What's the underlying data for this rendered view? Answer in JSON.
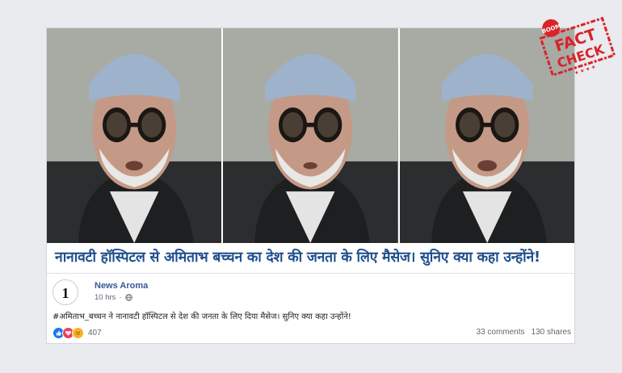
{
  "headline": "नानावटी हॉस्पिटल से अमिताभ बच्चन का देश की जनता के लिए मैसेज। सुनिए क्या कहा उन्होंने!",
  "post": {
    "page_name": "News Aroma",
    "time": "10 hrs",
    "separator": "·",
    "text": "#अमिताभ_बच्चन ने नानावटी हॉस्पिटल से देश की जनता के लिए दिया मैसेज। सुनिए क्या कहा उन्होंने!",
    "reaction_count": "407",
    "comments": "33 comments",
    "shares": "130 shares",
    "avatar_text": "1"
  },
  "stamp": {
    "brand": "BOOM",
    "line1": "FACT",
    "line2": "CHECK",
    "color": "#d9232a"
  },
  "icons": [
    "globe-icon",
    "like-reaction-icon",
    "love-reaction-icon",
    "sad-reaction-icon"
  ]
}
